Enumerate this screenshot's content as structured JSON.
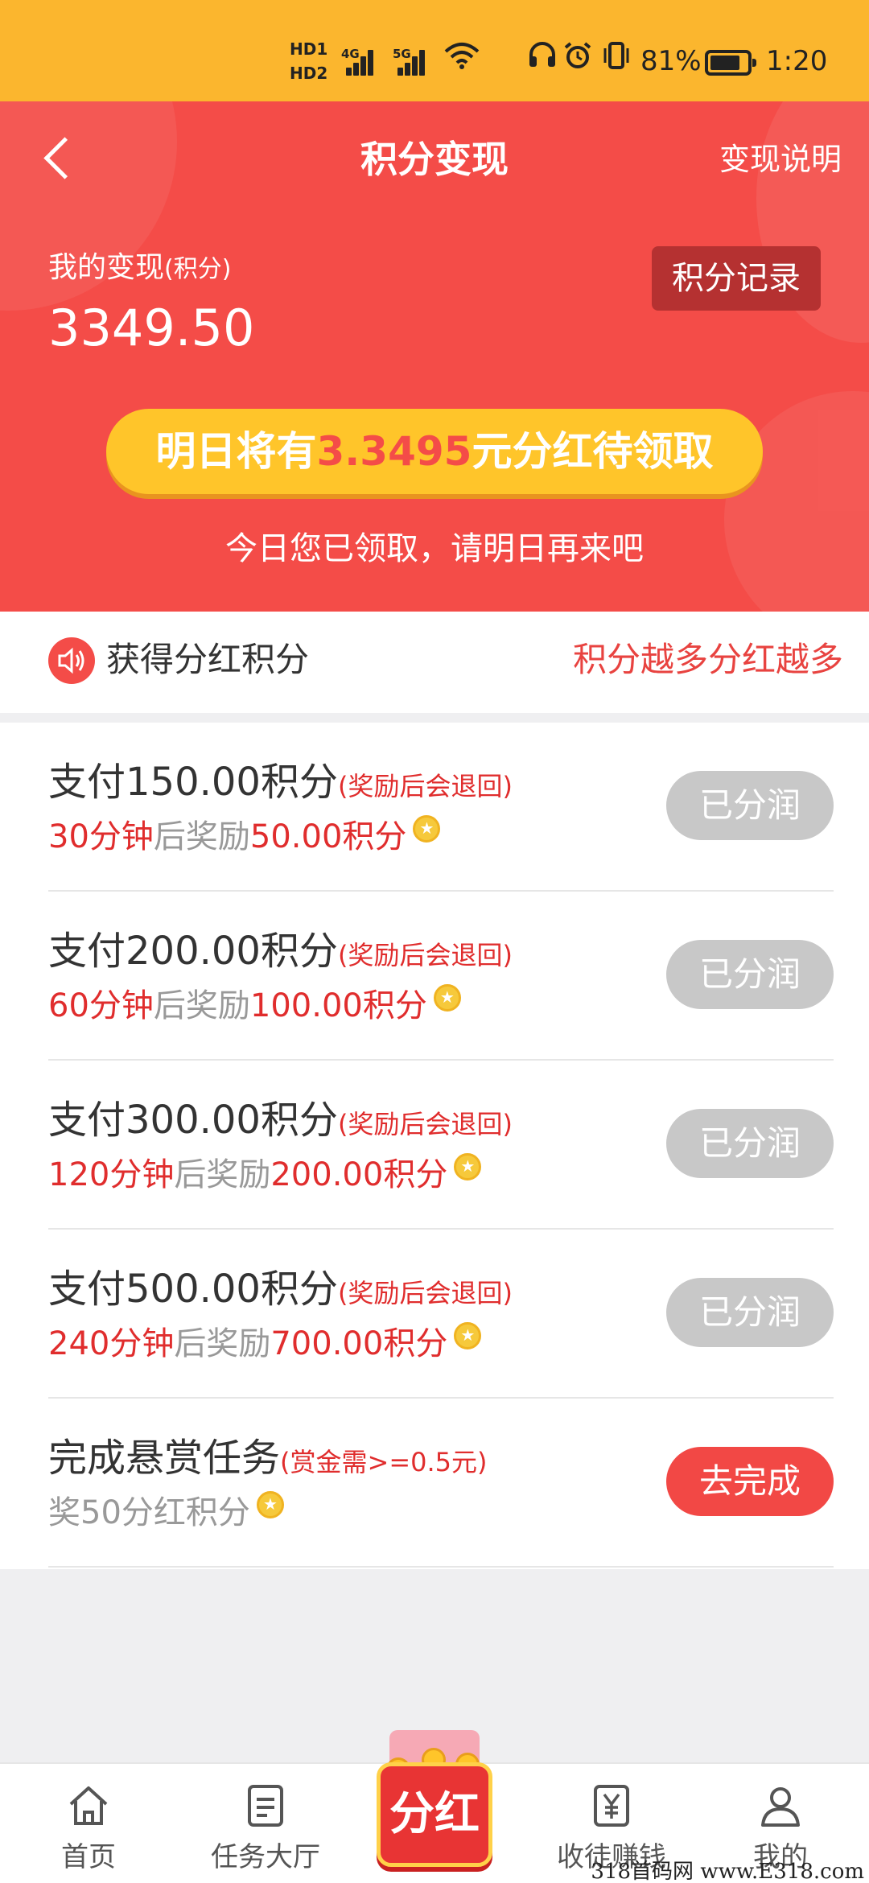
{
  "status_bar": {
    "hd_labels": "HD1\nHD2",
    "network1": "4G",
    "network2": "5G",
    "battery_text": "81%",
    "battery_level": 0.81,
    "time": "1:20"
  },
  "header": {
    "title": "积分变现",
    "explain_link": "变现说明"
  },
  "balance": {
    "label": "我的变现",
    "label_unit": "(积分)",
    "value": "3349.50",
    "record_button": "积分记录"
  },
  "dividend": {
    "prefix": "明日将有",
    "amount": "3.3495",
    "suffix": "元分红待领取",
    "note": "今日您已领取，请明日再来吧"
  },
  "info_bar": {
    "left": "获得分红积分",
    "right": "积分越多分红越多"
  },
  "tasks": [
    {
      "title": "支付150.00积分",
      "note": "(奖励后会退回)",
      "time": "30分钟",
      "mid": "后奖励",
      "reward": "50.00积分",
      "button": "已分润",
      "state": "done"
    },
    {
      "title": "支付200.00积分",
      "note": "(奖励后会退回)",
      "time": "60分钟",
      "mid": "后奖励",
      "reward": "100.00积分",
      "button": "已分润",
      "state": "done"
    },
    {
      "title": "支付300.00积分",
      "note": "(奖励后会退回)",
      "time": "120分钟",
      "mid": "后奖励",
      "reward": "200.00积分",
      "button": "已分润",
      "state": "done"
    },
    {
      "title": "支付500.00积分",
      "note": "(奖励后会退回)",
      "time": "240分钟",
      "mid": "后奖励",
      "reward": "700.00积分",
      "button": "已分润",
      "state": "done"
    },
    {
      "title": "完成悬赏任务",
      "note": "(赏金需>=0.5元)",
      "sub": "奖50分红积分",
      "button": "去完成",
      "state": "todo"
    }
  ],
  "bottom_nav": {
    "home": "首页",
    "tasks": "任务大厅",
    "center": "分红",
    "earn": "收徒赚钱",
    "mine": "我的"
  },
  "watermark": "318首码网 www.E318.com",
  "colors": {
    "primary_red": "#f44c48",
    "status_bar": "#fbb62e",
    "pill_yellow": "#ffc52a",
    "button_done": "#c8c8c8",
    "button_go": "#f24845"
  }
}
